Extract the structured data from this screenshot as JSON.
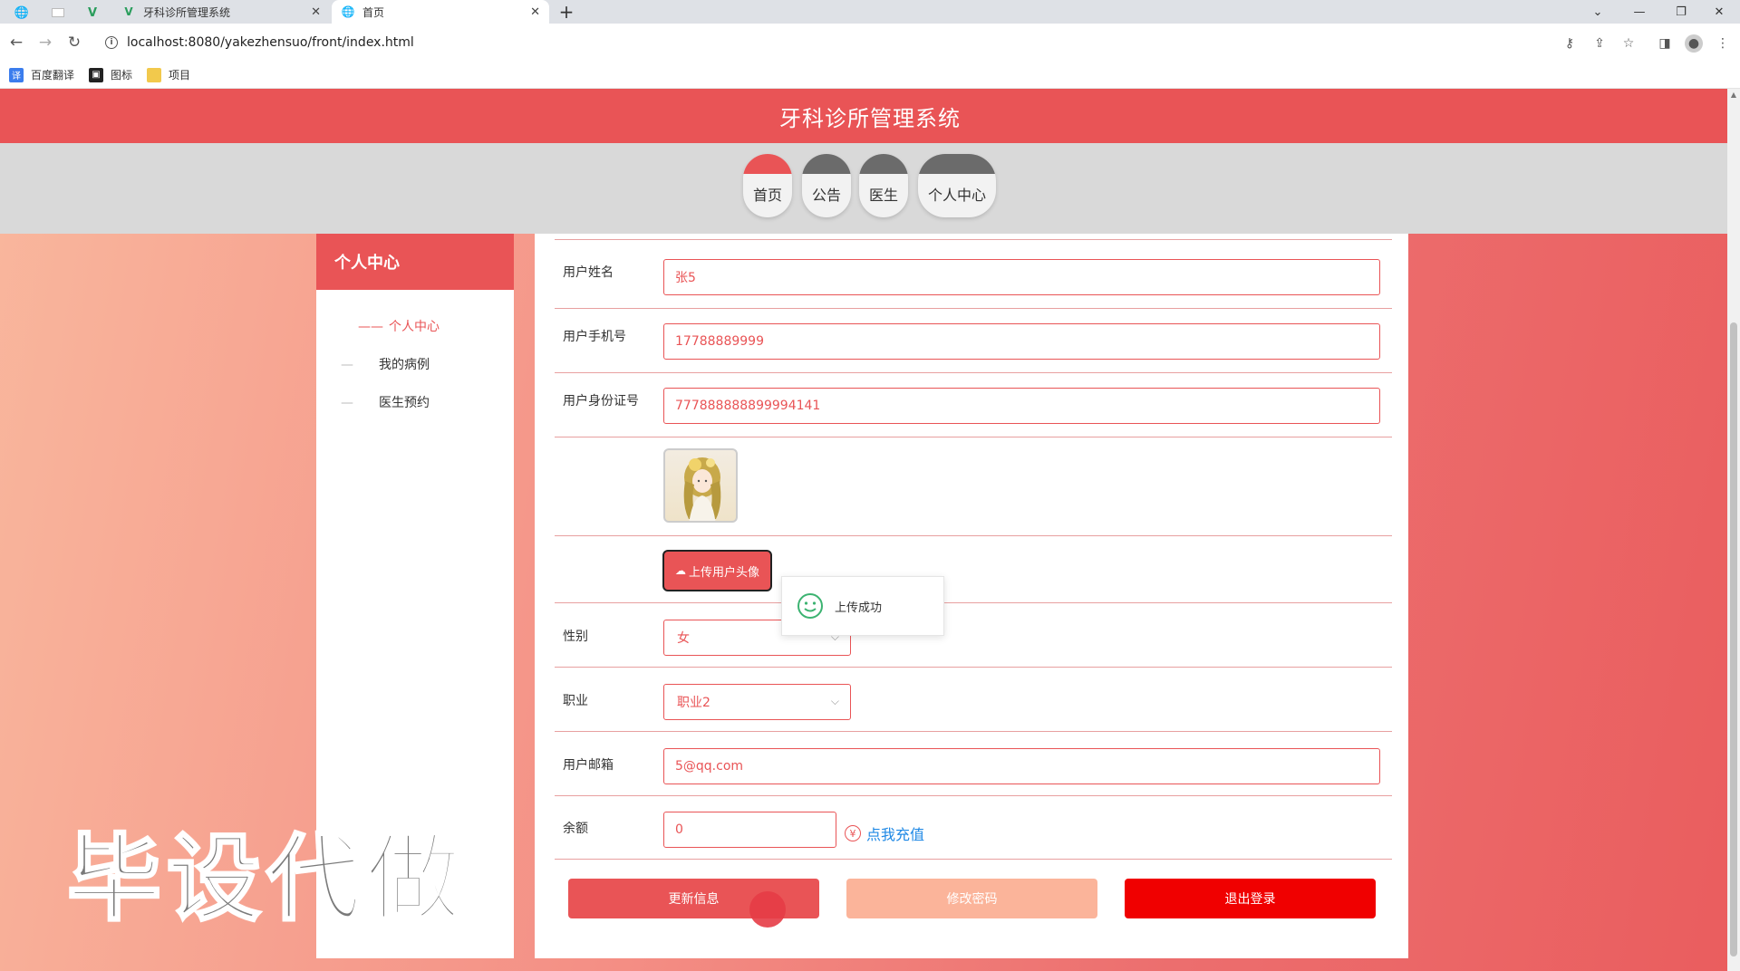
{
  "browser": {
    "tabs": [
      {
        "label": "牙科诊所管理系统",
        "active": false
      },
      {
        "label": "首页",
        "active": true
      }
    ],
    "url": "localhost:8080/yakezhensuo/front/index.html",
    "bookmarks": [
      {
        "label": "百度翻译",
        "icon": "baidu-translate-icon"
      },
      {
        "label": "图标",
        "icon": "image-icon"
      },
      {
        "label": "项目",
        "icon": "folder-icon"
      }
    ]
  },
  "header": {
    "title": "牙科诊所管理系统"
  },
  "nav": {
    "items": [
      "首页",
      "公告",
      "医生",
      "个人中心"
    ],
    "active": "首页"
  },
  "sidebar": {
    "title": "个人中心",
    "items": [
      {
        "label": "个人中心",
        "active": true
      },
      {
        "label": "我的病例",
        "active": false
      },
      {
        "label": "医生预约",
        "active": false
      }
    ]
  },
  "form": {
    "name": {
      "label": "用户姓名",
      "value": "张5"
    },
    "phone": {
      "label": "用户手机号",
      "value": "17788889999"
    },
    "idcard": {
      "label": "用户身份证号",
      "value": "777888888899994141"
    },
    "upload_label": "上传用户头像",
    "gender": {
      "label": "性别",
      "value": "女"
    },
    "job": {
      "label": "职业",
      "value": "职业2"
    },
    "email": {
      "label": "用户邮箱",
      "value": "5@qq.com"
    },
    "balance": {
      "label": "余额",
      "value": "0"
    },
    "recharge_label": "点我充值"
  },
  "toast": {
    "message": "上传成功"
  },
  "buttons": {
    "update": "更新信息",
    "change_password": "修改密码",
    "logout": "退出登录"
  },
  "watermark": "毕设代做",
  "colors": {
    "primary": "#e95456",
    "accent_light": "#fbb49a",
    "danger": "#f00000",
    "link": "#1e88e5"
  }
}
